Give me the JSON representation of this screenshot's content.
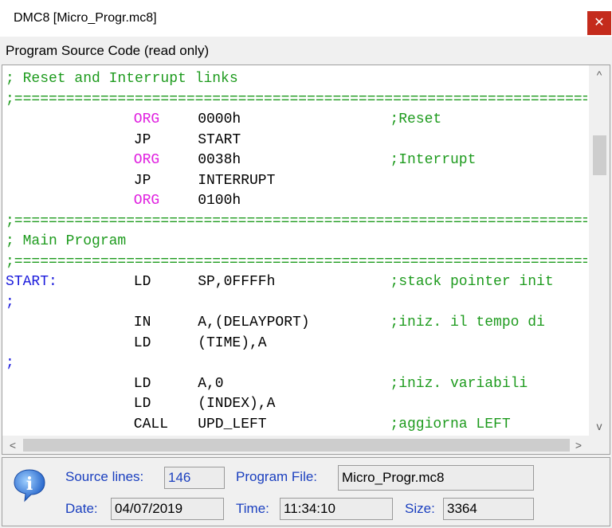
{
  "window": {
    "title": "DMC8 [Micro_Progr.mc8]",
    "close_symbol": "✕"
  },
  "panel": {
    "label": "Program Source Code (read only)"
  },
  "code_lines": [
    [
      {
        "t": "; Reset and Interrupt links",
        "c": "comment",
        "col": 0
      }
    ],
    [
      {
        "sep": true
      }
    ],
    [
      {
        "t": "ORG",
        "c": "org",
        "col": 16
      },
      {
        "t": "0000h",
        "c": "kw",
        "col": 24
      },
      {
        "t": ";Reset",
        "c": "comment",
        "col": 48
      }
    ],
    [
      {
        "t": "JP",
        "c": "kw",
        "col": 16
      },
      {
        "t": "START",
        "c": "kw",
        "col": 24
      }
    ],
    [
      {
        "t": "ORG",
        "c": "org",
        "col": 16
      },
      {
        "t": "0038h",
        "c": "kw",
        "col": 24
      },
      {
        "t": ";Interrupt",
        "c": "comment",
        "col": 48
      }
    ],
    [
      {
        "t": "JP",
        "c": "kw",
        "col": 16
      },
      {
        "t": "INTERRUPT",
        "c": "kw",
        "col": 24
      }
    ],
    [
      {
        "t": "ORG",
        "c": "org",
        "col": 16
      },
      {
        "t": "0100h",
        "c": "kw",
        "col": 24
      }
    ],
    [
      {
        "sep": true
      }
    ],
    [
      {
        "t": "; Main Program",
        "c": "comment",
        "col": 0
      }
    ],
    [
      {
        "sep": true
      }
    ],
    [
      {
        "t": "START:",
        "c": "label",
        "col": 0
      },
      {
        "t": "LD",
        "c": "kw",
        "col": 16
      },
      {
        "t": "SP,0FFFFh",
        "c": "kw",
        "col": 24
      },
      {
        "t": ";stack pointer init",
        "c": "comment",
        "col": 48
      }
    ],
    [
      {
        "t": ";",
        "c": "label",
        "col": 0
      }
    ],
    [
      {
        "t": "IN",
        "c": "kw",
        "col": 16
      },
      {
        "t": "A,(DELAYPORT)",
        "c": "kw",
        "col": 24
      },
      {
        "t": ";iniz. il tempo di",
        "c": "comment",
        "col": 48
      }
    ],
    [
      {
        "t": "LD",
        "c": "kw",
        "col": 16
      },
      {
        "t": "(TIME),A",
        "c": "kw",
        "col": 24
      }
    ],
    [
      {
        "t": ";",
        "c": "label",
        "col": 0
      }
    ],
    [
      {
        "t": "LD",
        "c": "kw",
        "col": 16
      },
      {
        "t": "A,0",
        "c": "kw",
        "col": 24
      },
      {
        "t": ";iniz. variabili",
        "c": "comment",
        "col": 48
      }
    ],
    [
      {
        "t": "LD",
        "c": "kw",
        "col": 16
      },
      {
        "t": "(INDEX),A",
        "c": "kw",
        "col": 24
      }
    ],
    [
      {
        "t": "CALL",
        "c": "kw",
        "col": 16
      },
      {
        "t": "UPD_LEFT",
        "c": "kw",
        "col": 24
      },
      {
        "t": ";aggiorna LEFT",
        "c": "comment",
        "col": 48
      }
    ]
  ],
  "separator_text": ";==========================================================================",
  "scroll": {
    "up": "^",
    "down": "v",
    "left": "<",
    "right": ">",
    "vertical_position": 0.18
  },
  "status": {
    "source_lines_label": "Source lines:",
    "source_lines_value": "146",
    "program_file_label": "Program File:",
    "program_file_value": "Micro_Progr.mc8",
    "date_label": "Date:",
    "date_value": "04/07/2019",
    "time_label": "Time:",
    "time_value": "11:34:10",
    "size_label": "Size:",
    "size_value": "3364",
    "info_glyph": "i"
  },
  "colors": {
    "comment": "#1e9b1e",
    "org": "#e020e0",
    "label": "#1a1adc",
    "field_label": "#1a3fbf",
    "close": "#c42b1c"
  }
}
